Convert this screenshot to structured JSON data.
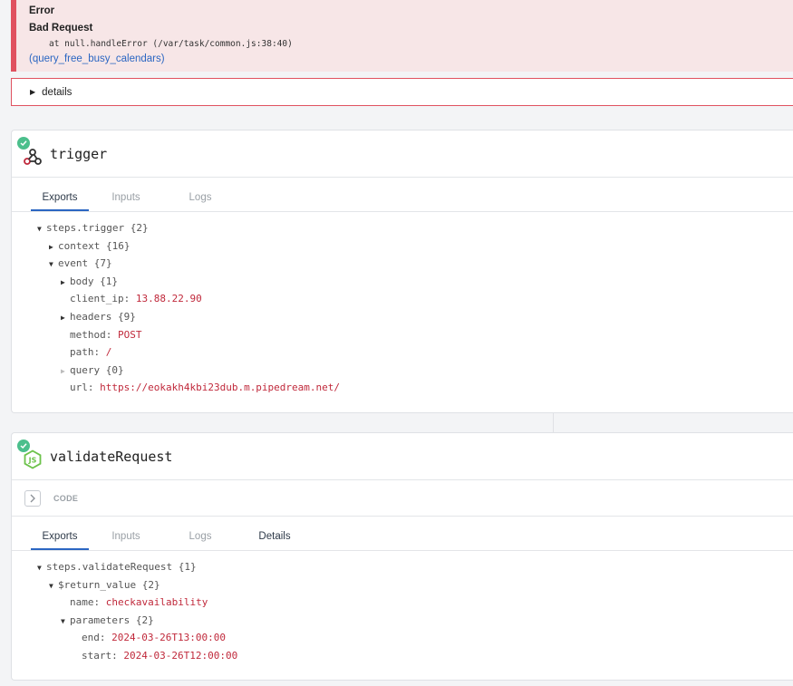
{
  "error": {
    "title": "Error",
    "message": "Bad Request",
    "stack": "at null.handleError (/var/task/common.js:38:40)",
    "link": "(query_free_busy_calendars)"
  },
  "details": {
    "label": "details"
  },
  "trigger": {
    "title": "trigger",
    "tabs": [
      "Exports",
      "Inputs",
      "Logs"
    ],
    "tree": {
      "root": "steps.trigger {2}",
      "context": "context {16}",
      "event": "event {7}",
      "body": "body {1}",
      "client_ip_key": "client_ip:",
      "client_ip_val": "13.88.22.90",
      "headers": "headers {9}",
      "method_key": "method:",
      "method_val": "POST",
      "path_key": "path:",
      "path_val": "/",
      "query": "query {0}",
      "url_key": "url:",
      "url_val": "https://eokakh4kbi23dub.m.pipedream.net/"
    }
  },
  "validate": {
    "title": "validateRequest",
    "code_label": "CODE",
    "tabs": [
      "Exports",
      "Inputs",
      "Logs",
      "Details"
    ],
    "tree": {
      "root": "steps.validateRequest {1}",
      "return_value": "$return_value {2}",
      "name_key": "name:",
      "name_val": "checkavailability",
      "parameters": "parameters {2}",
      "end_key": "end:",
      "end_val": "2024-03-26T13:00:00",
      "start_key": "start:",
      "start_val": "2024-03-26T12:00:00"
    }
  },
  "colors": {
    "error_accent": "#e05260",
    "success": "#4bbf8c",
    "tab_active": "#2b66c2",
    "value": "#c0293b"
  }
}
